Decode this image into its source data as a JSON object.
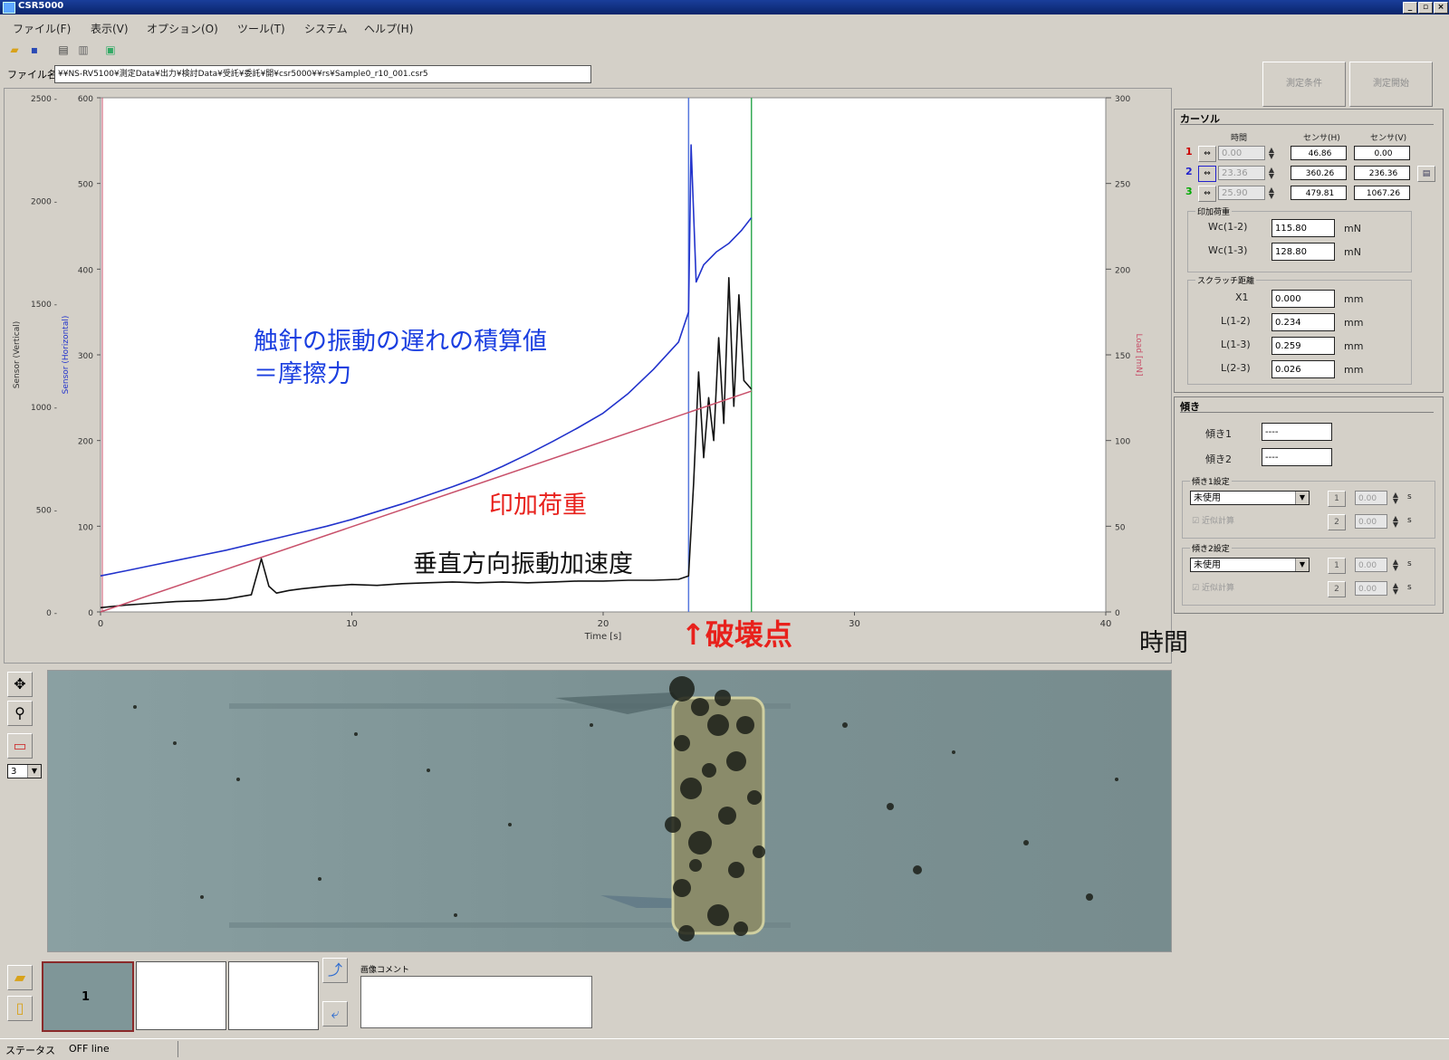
{
  "window": {
    "title": "CSR5000",
    "buttons": [
      "_",
      "▫",
      "×"
    ]
  },
  "menu": [
    "ファイル(F)",
    "表示(V)",
    "オプション(O)",
    "ツール(T)",
    "システム",
    "ヘルプ(H)"
  ],
  "toolbar": [
    "open-icon",
    "save-icon",
    "print-icon",
    "preview-icon",
    "capture-icon"
  ],
  "file": {
    "label": "ファイル名",
    "value": "¥¥NS-RV5100¥測定Data¥出力¥検討Data¥受託¥委託¥開¥csr5000¥¥rs¥Sample0_r10_001.csr5"
  },
  "top_buttons": {
    "measure_result": "測定条件",
    "start": "測定開始"
  },
  "annotations": {
    "friction": "触針の振動の遅れの積算値",
    "friction2": "＝摩擦力",
    "load": "印加荷重",
    "accel": "垂直方向振動加速度",
    "break_point": "破壊点",
    "time": "時間"
  },
  "chart_data": {
    "type": "line",
    "title": "",
    "xlabel": "Time [s]",
    "ylabel_left_outer": "Sensor (Vertical)",
    "ylabel_left_inner": "Sensor (Horizontal)",
    "ylabel_right": "Load [mN]",
    "xlim": [
      0,
      40
    ],
    "x_ticks": [
      "0",
      "10",
      "20",
      "30",
      "40"
    ],
    "y_outer": {
      "lim": [
        0,
        2500
      ],
      "ticks": [
        "0 -",
        "500 -",
        "1000 -",
        "1500 -",
        "2000 -",
        "2500 -"
      ]
    },
    "y_inner": {
      "lim": [
        0,
        600
      ],
      "ticks": [
        "0",
        "100",
        "200",
        "300",
        "400",
        "500",
        "600"
      ]
    },
    "y_right": {
      "lim": [
        0,
        300
      ],
      "ticks": [
        "0",
        "50",
        "100",
        "150",
        "200",
        "250",
        "300"
      ]
    },
    "cursor_lines": [
      23.4,
      25.9
    ],
    "colors": {
      "horizontal": "#2233cc",
      "vertical": "#111111",
      "load": "#c8506a",
      "cursor1": "#5577dd",
      "cursor2": "#33aa55",
      "annot_blue": "#1a3ee0",
      "annot_red": "#e8211c"
    },
    "series": [
      {
        "name": "Sensor (Horizontal)",
        "axis": "inner",
        "x": [
          0,
          1,
          2,
          3,
          4,
          5,
          6,
          7,
          8,
          9,
          10,
          11,
          12,
          13,
          14,
          15,
          16,
          17,
          18,
          19,
          20,
          21,
          22,
          23,
          23.4,
          23.5,
          23.7,
          24,
          24.5,
          25,
          25.5,
          25.9
        ],
        "values": [
          42,
          48,
          54,
          60,
          66,
          72,
          79,
          86,
          93,
          100,
          108,
          117,
          126,
          136,
          146,
          157,
          170,
          184,
          199,
          215,
          232,
          255,
          283,
          315,
          350,
          545,
          385,
          405,
          420,
          430,
          445,
          460
        ]
      },
      {
        "name": "Sensor (Vertical)",
        "axis": "inner",
        "x": [
          0,
          1,
          2,
          3,
          4,
          5,
          6,
          6.4,
          6.7,
          7,
          7.5,
          8,
          9,
          10,
          11,
          12,
          13,
          14,
          15,
          16,
          17,
          18,
          19,
          20,
          21,
          22,
          23,
          23.4,
          23.6,
          23.8,
          24,
          24.2,
          24.4,
          24.6,
          24.8,
          25,
          25.2,
          25.4,
          25.6,
          25.9
        ],
        "values": [
          5,
          8,
          10,
          12,
          13,
          15,
          20,
          62,
          30,
          22,
          25,
          27,
          30,
          32,
          31,
          33,
          34,
          35,
          34,
          35,
          34,
          35,
          36,
          36,
          37,
          37,
          38,
          42,
          150,
          280,
          180,
          250,
          200,
          320,
          220,
          390,
          240,
          370,
          270,
          260
        ]
      },
      {
        "name": "Load",
        "axis": "right",
        "x": [
          0,
          25.9
        ],
        "values": [
          0,
          128.8
        ]
      }
    ]
  },
  "cursor_panel": {
    "title": "カーソル",
    "headers": [
      "時間",
      "センサ(H)",
      "センサ(V)"
    ],
    "rows": [
      {
        "id": "1",
        "time": "0.00",
        "h": "46.86",
        "v": "0.00"
      },
      {
        "id": "2",
        "time": "23.36",
        "h": "360.26",
        "v": "236.36"
      },
      {
        "id": "3",
        "time": "25.90",
        "h": "479.81",
        "v": "1067.26"
      }
    ],
    "load_group": "印加荷重",
    "wc12_label": "Wc(1-2)",
    "wc12": "115.80",
    "wc13_label": "Wc(1-3)",
    "wc13": "128.80",
    "unit_mn": "mN",
    "scratch_group": "スクラッチ距離",
    "x1_label": "X1",
    "x1": "0.000",
    "l12_label": "L(1-2)",
    "l12": "0.234",
    "l13_label": "L(1-3)",
    "l13": "0.259",
    "l23_label": "L(2-3)",
    "l23": "0.026",
    "unit_mm": "mm"
  },
  "slope_panel": {
    "title": "傾き",
    "s1_label": "傾き1",
    "s1": "----",
    "s2_label": "傾き2",
    "s2": "----",
    "g1": "傾き1設定",
    "g2": "傾き2設定",
    "unused": "未使用",
    "check": "近似計算",
    "b1": "1",
    "b2": "2",
    "v": "0.00",
    "unit": "s"
  },
  "bottom": {
    "comment_label": "画像コメント",
    "thumb_number": "1",
    "zoom_value": "3",
    "status_label": "ステータス",
    "status_value": "OFF line"
  }
}
